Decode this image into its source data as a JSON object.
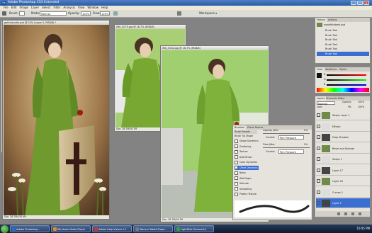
{
  "app": {
    "title": "Adobe Photoshop CS3 Extended",
    "logo": "Ps",
    "window_buttons": [
      "_",
      "□",
      "×"
    ]
  },
  "menu": [
    "File",
    "Edit",
    "Image",
    "Layer",
    "Select",
    "Filter",
    "Analysis",
    "View",
    "Window",
    "Help"
  ],
  "options": {
    "brush_label": "Brush:",
    "mode_label": "Mode:",
    "mode_value": "Normal",
    "opacity_label": "Opacity:",
    "opacity_value": "100%",
    "flow_label": "Flow:",
    "flow_value": "100%",
    "workspace_label": "Workspace ▾"
  },
  "documents": [
    {
      "title": "gothicstudio.psd @ 25% (Layer 5, RGB/8) *",
      "status": "Doc: 26.7M/150.4M"
    },
    {
      "title": "IMG_0075.jpg @ 16.7% (RGB/8)",
      "status": "Doc: 26.7M/26.7M"
    },
    {
      "title": "IMG_0042.jpg @ 16.7% (RGB/8)",
      "status": "Doc: 26.7M/26.7M"
    }
  ],
  "history_panel": {
    "tabs": [
      "History",
      "Actions"
    ],
    "snapshot": "woodfotobest.psd",
    "items": [
      "Brush Tool",
      "Brush Tool",
      "Brush Tool",
      "Brush Tool",
      "Brush Tool",
      "Brush Tool"
    ]
  },
  "color_panel": {
    "tabs": [
      "Color",
      "Swatches",
      "Styles"
    ],
    "channels": [
      "R",
      "G",
      "B"
    ]
  },
  "layers_panel": {
    "tabs": [
      "Layers",
      "Channels",
      "Paths"
    ],
    "blend_mode": "Normal",
    "opacity_label": "Opacity:",
    "opacity_value": "100%",
    "fill_label": "Fill:",
    "fill_value": "100%",
    "lock_label": "Lock:",
    "layers": [
      {
        "name": "Shape Layer 1",
        "sub": ""
      },
      {
        "name": "Effects",
        "sub": ""
      },
      {
        "name": "Drop Shadow",
        "sub": ""
      },
      {
        "name": "Bevel and Emboss",
        "sub": ""
      },
      {
        "name": "Shape 1",
        "sub": ""
      },
      {
        "name": "Layer 17",
        "sub": ""
      },
      {
        "name": "Layer 16",
        "sub": ""
      },
      {
        "name": "Curves 1",
        "sub": ""
      },
      {
        "name": "Layer 5",
        "sub": ""
      }
    ]
  },
  "brushes_panel": {
    "tabs": [
      "Brushes",
      "Clone Source"
    ],
    "presets": "Brush Presets",
    "tip": "Brush Tip Shape",
    "options": [
      "Shape Dynamics",
      "Scattering",
      "Texture",
      "Dual Brush",
      "Color Dynamics",
      "Other Dynamics",
      "Noise",
      "Wet Edges",
      "Airbrush",
      "Smoothing",
      "Protect Texture"
    ],
    "selected": "Other Dynamics",
    "opacity_jitter_label": "Opacity Jitter",
    "opacity_jitter_value": "0%",
    "control_label": "Control:",
    "control_value": "Pen Pressure",
    "flow_jitter_label": "Flow Jitter",
    "flow_jitter_value": "0%",
    "control2_value": "Pen Pressure"
  },
  "taskbar": {
    "tasks": [
      {
        "label": "Adobe Photoshop...",
        "color": "#2a6bc4"
      },
      {
        "label": "Windows Media Player",
        "color": "#e58a1f"
      },
      {
        "label": "Adobe Help Viewer 1.1",
        "color": "#c23a2a"
      },
      {
        "label": "Wacom Tablet Prope...",
        "color": "#7a7a7a"
      },
      {
        "label": "LightRide Gerenacht",
        "color": "#3aa13a"
      }
    ],
    "clock": "10:05 PM"
  },
  "colors": {
    "titlebar": "#2a5aa8",
    "dress_green": "#7fb23a",
    "wall_green": "#9fcf6e",
    "sepia_bg": "#7a5a38"
  }
}
